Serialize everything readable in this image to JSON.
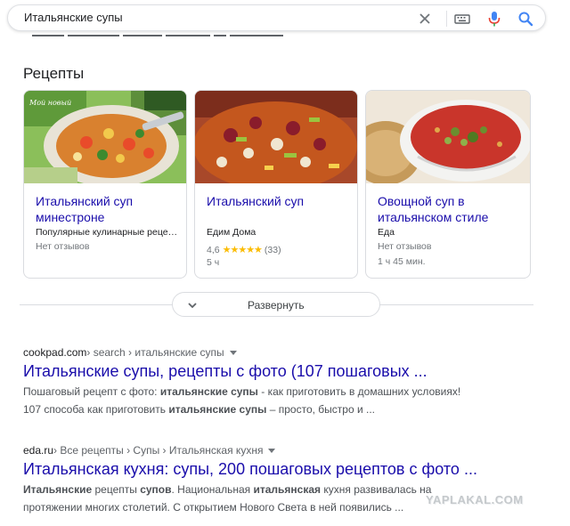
{
  "search": {
    "query": "Итальянские супы"
  },
  "recipes": {
    "heading": "Рецепты",
    "cards": [
      {
        "title": "Итальянский суп минестроне",
        "source": "Популярные кулинарные рецепты",
        "reviews": "Нет отзывов",
        "image_caption": "Мой новый"
      },
      {
        "title": "Итальянский суп",
        "source": "Едим Дома",
        "rating_value": "4,6",
        "rating_stars": 4.6,
        "rating_count": "(33)",
        "time": "5 ч"
      },
      {
        "title": "Овощной суп в итальянском стиле",
        "source": "Еда",
        "reviews": "Нет отзывов",
        "time": "1 ч 45 мин."
      }
    ],
    "expand_label": "Развернуть"
  },
  "results": [
    {
      "domain": "cookpad.com",
      "breadcrumb": " › search › итальянские супы",
      "title": "Итальянские супы, рецепты с фото (107 пошаговых ...",
      "snippet1_a": "Пошаговый рецепт с фото: ",
      "snippet1_b": "итальянские супы",
      "snippet1_c": " - как приготовить в домашних условиях!",
      "snippet2_a": "107 способа как приготовить ",
      "snippet2_b": "итальянские супы",
      "snippet2_c": " – просто, быстро и ..."
    },
    {
      "domain": "eda.ru",
      "breadcrumb": " › Все рецепты › Супы › Итальянская кухня",
      "title": "Итальянская кухня: супы, 200 пошаговых рецептов с фото ...",
      "snippet1_a": "Итальянские",
      "snippet1_b": " рецепты ",
      "snippet1_c": "супов",
      "snippet1_d": ". Национальная ",
      "snippet1_e": "итальянская",
      "snippet1_f": " кухня развивалась на",
      "snippet2": "протяжении многих столетий. С открытием Нового Света в ней появились ..."
    }
  ],
  "watermark": "YAPLAKAL.COM",
  "colors": {
    "link": "#1a0dab",
    "star": "#fbbc04",
    "mic_blue": "#4285f4",
    "mic_red": "#ea4335"
  }
}
